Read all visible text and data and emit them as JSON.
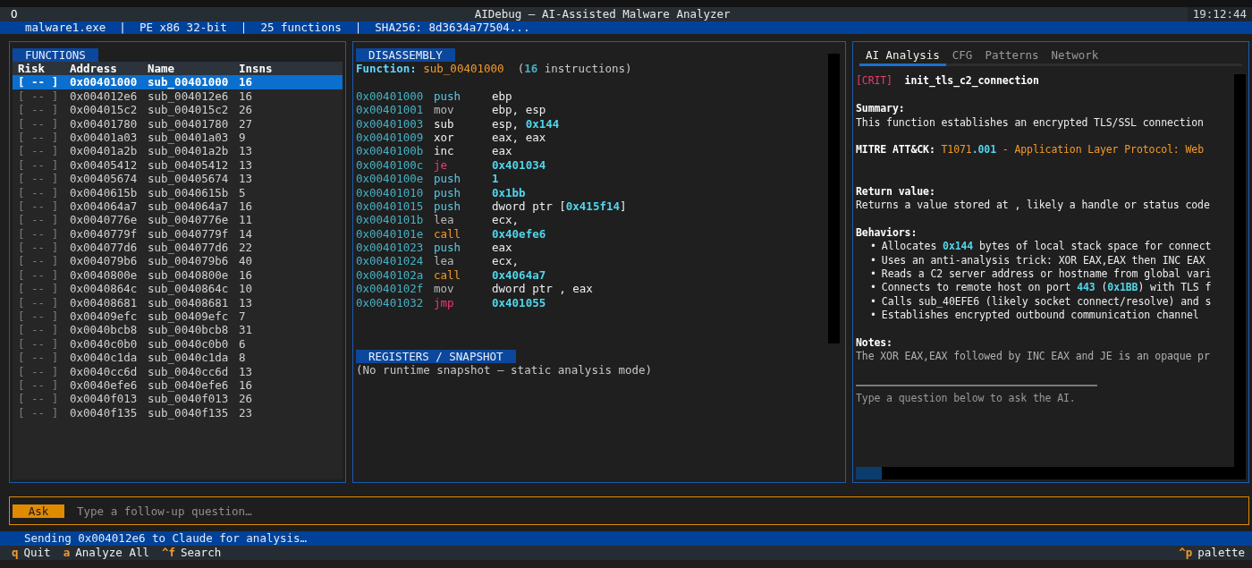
{
  "window": {
    "icon_glyph": "O",
    "title": "AIDebug — AI-Assisted Malware Analyzer",
    "clock": "19:12:44"
  },
  "info_bar": "malware1.exe  |  PE x86 32-bit  |  25 functions  |  SHA256: 8d3634a77504...",
  "functions": {
    "title": "FUNCTIONS",
    "columns": [
      "Risk",
      "Address",
      "Name",
      "Insns"
    ],
    "rows": [
      {
        "risk": "[ -- ]",
        "address": "0x00401000",
        "name": "sub_00401000",
        "insns": "16",
        "selected": true
      },
      {
        "risk": "[ -- ]",
        "address": "0x004012e6",
        "name": "sub_004012e6",
        "insns": "16",
        "selected": false
      },
      {
        "risk": "[ -- ]",
        "address": "0x004015c2",
        "name": "sub_004015c2",
        "insns": "26",
        "selected": false
      },
      {
        "risk": "[ -- ]",
        "address": "0x00401780",
        "name": "sub_00401780",
        "insns": "27",
        "selected": false
      },
      {
        "risk": "[ -- ]",
        "address": "0x00401a03",
        "name": "sub_00401a03",
        "insns": "9",
        "selected": false
      },
      {
        "risk": "[ -- ]",
        "address": "0x00401a2b",
        "name": "sub_00401a2b",
        "insns": "13",
        "selected": false
      },
      {
        "risk": "[ -- ]",
        "address": "0x00405412",
        "name": "sub_00405412",
        "insns": "13",
        "selected": false
      },
      {
        "risk": "[ -- ]",
        "address": "0x00405674",
        "name": "sub_00405674",
        "insns": "13",
        "selected": false
      },
      {
        "risk": "[ -- ]",
        "address": "0x0040615b",
        "name": "sub_0040615b",
        "insns": "5",
        "selected": false
      },
      {
        "risk": "[ -- ]",
        "address": "0x004064a7",
        "name": "sub_004064a7",
        "insns": "16",
        "selected": false
      },
      {
        "risk": "[ -- ]",
        "address": "0x0040776e",
        "name": "sub_0040776e",
        "insns": "11",
        "selected": false
      },
      {
        "risk": "[ -- ]",
        "address": "0x0040779f",
        "name": "sub_0040779f",
        "insns": "14",
        "selected": false
      },
      {
        "risk": "[ -- ]",
        "address": "0x004077d6",
        "name": "sub_004077d6",
        "insns": "22",
        "selected": false
      },
      {
        "risk": "[ -- ]",
        "address": "0x004079b6",
        "name": "sub_004079b6",
        "insns": "40",
        "selected": false
      },
      {
        "risk": "[ -- ]",
        "address": "0x0040800e",
        "name": "sub_0040800e",
        "insns": "16",
        "selected": false
      },
      {
        "risk": "[ -- ]",
        "address": "0x0040864c",
        "name": "sub_0040864c",
        "insns": "10",
        "selected": false
      },
      {
        "risk": "[ -- ]",
        "address": "0x00408681",
        "name": "sub_00408681",
        "insns": "13",
        "selected": false
      },
      {
        "risk": "[ -- ]",
        "address": "0x00409efc",
        "name": "sub_00409efc",
        "insns": "7",
        "selected": false
      },
      {
        "risk": "[ -- ]",
        "address": "0x0040bcb8",
        "name": "sub_0040bcb8",
        "insns": "31",
        "selected": false
      },
      {
        "risk": "[ -- ]",
        "address": "0x0040c0b0",
        "name": "sub_0040c0b0",
        "insns": "6",
        "selected": false
      },
      {
        "risk": "[ -- ]",
        "address": "0x0040c1da",
        "name": "sub_0040c1da",
        "insns": "8",
        "selected": false
      },
      {
        "risk": "[ -- ]",
        "address": "0x0040cc6d",
        "name": "sub_0040cc6d",
        "insns": "13",
        "selected": false
      },
      {
        "risk": "[ -- ]",
        "address": "0x0040efe6",
        "name": "sub_0040efe6",
        "insns": "16",
        "selected": false
      },
      {
        "risk": "[ -- ]",
        "address": "0x0040f013",
        "name": "sub_0040f013",
        "insns": "26",
        "selected": false
      },
      {
        "risk": "[ -- ]",
        "address": "0x0040f135",
        "name": "sub_0040f135",
        "insns": "23",
        "selected": false
      }
    ]
  },
  "disassembly": {
    "title": "DISASSEMBLY",
    "function_label": "Function:",
    "function_name": "sub_00401000",
    "count_open": "(",
    "count": "16",
    "count_rest": " instructions)",
    "instructions": [
      {
        "address": "0x00401000",
        "mnemonic": "push",
        "kind": "stack",
        "operand": [
          {
            "text": "ebp",
            "kind": "plain"
          }
        ]
      },
      {
        "address": "0x00401001",
        "mnemonic": "mov",
        "kind": "move",
        "operand": [
          {
            "text": "ebp, esp",
            "kind": "plain"
          }
        ]
      },
      {
        "address": "0x00401003",
        "mnemonic": "sub",
        "kind": "arith",
        "operand": [
          {
            "text": "esp, ",
            "kind": "plain"
          },
          {
            "text": "0x144",
            "kind": "num"
          }
        ]
      },
      {
        "address": "0x00401009",
        "mnemonic": "xor",
        "kind": "arith",
        "operand": [
          {
            "text": "eax, eax",
            "kind": "plain"
          }
        ]
      },
      {
        "address": "0x0040100b",
        "mnemonic": "inc",
        "kind": "arith",
        "operand": [
          {
            "text": "eax",
            "kind": "plain"
          }
        ]
      },
      {
        "address": "0x0040100c",
        "mnemonic": "je",
        "kind": "branch",
        "operand": [
          {
            "text": "0x401034",
            "kind": "num"
          }
        ]
      },
      {
        "address": "0x0040100e",
        "mnemonic": "push",
        "kind": "stack",
        "operand": [
          {
            "text": "1",
            "kind": "num"
          }
        ]
      },
      {
        "address": "0x00401010",
        "mnemonic": "push",
        "kind": "stack",
        "operand": [
          {
            "text": "0x1bb",
            "kind": "num"
          }
        ]
      },
      {
        "address": "0x00401015",
        "mnemonic": "push",
        "kind": "stack",
        "operand": [
          {
            "text": "dword ptr [",
            "kind": "plain"
          },
          {
            "text": "0x415f14",
            "kind": "num"
          },
          {
            "text": "]",
            "kind": "plain"
          }
        ]
      },
      {
        "address": "0x0040101b",
        "mnemonic": "lea",
        "kind": "move",
        "operand": [
          {
            "text": "ecx,",
            "kind": "plain"
          }
        ]
      },
      {
        "address": "0x0040101e",
        "mnemonic": "call",
        "kind": "call",
        "operand": [
          {
            "text": "0x40efe6",
            "kind": "num"
          }
        ]
      },
      {
        "address": "0x00401023",
        "mnemonic": "push",
        "kind": "stack",
        "operand": [
          {
            "text": "eax",
            "kind": "plain"
          }
        ]
      },
      {
        "address": "0x00401024",
        "mnemonic": "lea",
        "kind": "move",
        "operand": [
          {
            "text": "ecx,",
            "kind": "plain"
          }
        ]
      },
      {
        "address": "0x0040102a",
        "mnemonic": "call",
        "kind": "call",
        "operand": [
          {
            "text": "0x4064a7",
            "kind": "num"
          }
        ]
      },
      {
        "address": "0x0040102f",
        "mnemonic": "mov",
        "kind": "move",
        "operand": [
          {
            "text": "dword ptr , eax",
            "kind": "plain"
          }
        ]
      },
      {
        "address": "0x00401032",
        "mnemonic": "jmp",
        "kind": "branch",
        "operand": [
          {
            "text": "0x401055",
            "kind": "num"
          }
        ]
      }
    ],
    "registers_title": "REGISTERS / SNAPSHOT",
    "registers_text": "(No runtime snapshot — static analysis mode)"
  },
  "analysis": {
    "tabs": [
      {
        "label": "AI Analysis",
        "selected": true
      },
      {
        "label": "CFG",
        "selected": false
      },
      {
        "label": "Patterns",
        "selected": false
      },
      {
        "label": "Network",
        "selected": false
      }
    ],
    "severity": "[CRIT]",
    "function_name": "init_tls_c2_connection",
    "sections": [
      {
        "kind": "text",
        "heading": "Summary:",
        "lines": [
          [
            {
              "text": "This function establishes an encrypted TLS/SSL connection",
              "kind": "plain"
            }
          ]
        ]
      },
      {
        "kind": "mitre",
        "heading": "MITRE ATT&CK:",
        "lines": [
          [
            {
              "text": "T1071",
              "kind": "id"
            },
            {
              "text": ".001",
              "kind": "num"
            },
            {
              "text": " - Application Layer Protocol: Web",
              "kind": "id"
            }
          ]
        ]
      },
      {
        "kind": "text",
        "heading": "Return value:",
        "lines": [
          [
            {
              "text": "Returns a value stored at , likely a handle or status code",
              "kind": "plain"
            }
          ]
        ]
      },
      {
        "kind": "bullets",
        "heading": "Behaviors:",
        "lines": [
          [
            {
              "text": "Allocates ",
              "kind": "plain"
            },
            {
              "text": "0x144",
              "kind": "num"
            },
            {
              "text": " bytes of local stack space for connect",
              "kind": "plain"
            }
          ],
          [
            {
              "text": "Uses an anti-analysis trick: XOR EAX,EAX then INC EAX",
              "kind": "plain"
            }
          ],
          [
            {
              "text": "Reads a C2 server address or hostname from global vari",
              "kind": "plain"
            }
          ],
          [
            {
              "text": "Connects to remote host on port ",
              "kind": "plain"
            },
            {
              "text": "443",
              "kind": "num"
            },
            {
              "text": " (",
              "kind": "plain"
            },
            {
              "text": "0x1BB",
              "kind": "num"
            },
            {
              "text": ") with TLS f",
              "kind": "plain"
            }
          ],
          [
            {
              "text": "Calls sub_40EFE6 (likely socket connect/resolve) and s",
              "kind": "plain"
            }
          ],
          [
            {
              "text": "Establishes encrypted outbound communication channel",
              "kind": "plain"
            }
          ]
        ]
      },
      {
        "kind": "notes",
        "heading": "Notes:",
        "lines": [
          [
            {
              "text": "The XOR EAX,EAX followed by INC EAX and JE is an opaque pr",
              "kind": "plain"
            }
          ]
        ]
      }
    ],
    "bullet": "•",
    "hint": "Type a question below to ask the AI."
  },
  "ask": {
    "button": "Ask",
    "placeholder": "Type a follow-up question…"
  },
  "status": "Sending 0x004012e6 to Claude for analysis…",
  "shortcuts": [
    {
      "key": "q",
      "label": "Quit"
    },
    {
      "key": "a",
      "label": "Analyze All"
    },
    {
      "key": "^f",
      "label": "Search"
    }
  ],
  "palette": {
    "key": "^p",
    "label": "palette"
  }
}
